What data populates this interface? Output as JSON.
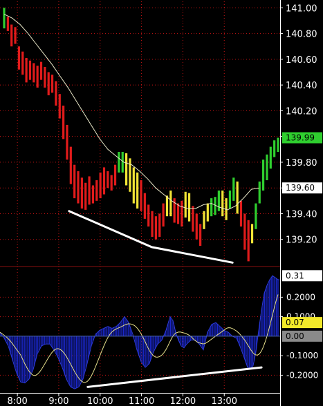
{
  "chart_data": [
    {
      "type": "bar",
      "panel": "price",
      "ylim": [
        139.0,
        141.05
      ],
      "yticks": [
        "141.00",
        "140.80",
        "140.60",
        "140.40",
        "140.20",
        "140.00",
        "139.80",
        "139.60",
        "139.40",
        "139.20"
      ],
      "ytick_values": [
        141.0,
        140.8,
        140.6,
        140.4,
        140.2,
        140.0,
        139.8,
        139.6,
        139.4,
        139.2
      ],
      "last_price_tag": "139.99",
      "ma_price_tag": "139.60",
      "colors": {
        "down": "#e11b1b",
        "up_weak": "#f2e436",
        "up": "#2fcf2f",
        "ma": "#e9e7c8",
        "trendline": "#ffffff",
        "grid": "#c81414",
        "axis_bg": "#000000"
      },
      "bars": [
        {
          "h": 141.0,
          "l": 140.84,
          "c": "g"
        },
        {
          "h": 140.93,
          "l": 140.82,
          "c": "r"
        },
        {
          "h": 140.87,
          "l": 140.7,
          "c": "r"
        },
        {
          "h": 140.85,
          "l": 140.72,
          "c": "r"
        },
        {
          "h": 140.7,
          "l": 140.52,
          "c": "r"
        },
        {
          "h": 140.66,
          "l": 140.48,
          "c": "r"
        },
        {
          "h": 140.61,
          "l": 140.42,
          "c": "r"
        },
        {
          "h": 140.59,
          "l": 140.44,
          "c": "r"
        },
        {
          "h": 140.57,
          "l": 140.42,
          "c": "r"
        },
        {
          "h": 140.55,
          "l": 140.38,
          "c": "r"
        },
        {
          "h": 140.58,
          "l": 140.44,
          "c": "r"
        },
        {
          "h": 140.54,
          "l": 140.38,
          "c": "r"
        },
        {
          "h": 140.5,
          "l": 140.32,
          "c": "r"
        },
        {
          "h": 140.48,
          "l": 140.34,
          "c": "r"
        },
        {
          "h": 140.43,
          "l": 140.24,
          "c": "r"
        },
        {
          "h": 140.33,
          "l": 140.14,
          "c": "r"
        },
        {
          "h": 140.24,
          "l": 139.98,
          "c": "r"
        },
        {
          "h": 140.09,
          "l": 139.82,
          "c": "r"
        },
        {
          "h": 139.92,
          "l": 139.63,
          "c": "r"
        },
        {
          "h": 139.78,
          "l": 139.52,
          "c": "r"
        },
        {
          "h": 139.73,
          "l": 139.48,
          "c": "r"
        },
        {
          "h": 139.68,
          "l": 139.44,
          "c": "r"
        },
        {
          "h": 139.64,
          "l": 139.43,
          "c": "r"
        },
        {
          "h": 139.69,
          "l": 139.47,
          "c": "r"
        },
        {
          "h": 139.62,
          "l": 139.48,
          "c": "r"
        },
        {
          "h": 139.66,
          "l": 139.5,
          "c": "r"
        },
        {
          "h": 139.72,
          "l": 139.52,
          "c": "r"
        },
        {
          "h": 139.76,
          "l": 139.55,
          "c": "r"
        },
        {
          "h": 139.73,
          "l": 139.6,
          "c": "r"
        },
        {
          "h": 139.7,
          "l": 139.58,
          "c": "r"
        },
        {
          "h": 139.78,
          "l": 139.62,
          "c": "r"
        },
        {
          "h": 139.88,
          "l": 139.72,
          "c": "g"
        },
        {
          "h": 139.88,
          "l": 139.72,
          "c": "g"
        },
        {
          "h": 139.87,
          "l": 139.62,
          "c": "y"
        },
        {
          "h": 139.83,
          "l": 139.57,
          "c": "y"
        },
        {
          "h": 139.76,
          "l": 139.48,
          "c": "y"
        },
        {
          "h": 139.72,
          "l": 139.44,
          "c": "y"
        },
        {
          "h": 139.66,
          "l": 139.42,
          "c": "r"
        },
        {
          "h": 139.56,
          "l": 139.36,
          "c": "r"
        },
        {
          "h": 139.47,
          "l": 139.3,
          "c": "r"
        },
        {
          "h": 139.42,
          "l": 139.22,
          "c": "r"
        },
        {
          "h": 139.38,
          "l": 139.2,
          "c": "r"
        },
        {
          "h": 139.4,
          "l": 139.22,
          "c": "r"
        },
        {
          "h": 139.48,
          "l": 139.3,
          "c": "r"
        },
        {
          "h": 139.54,
          "l": 139.38,
          "c": "y"
        },
        {
          "h": 139.58,
          "l": 139.38,
          "c": "y"
        },
        {
          "h": 139.52,
          "l": 139.33,
          "c": "r"
        },
        {
          "h": 139.48,
          "l": 139.32,
          "c": "r"
        },
        {
          "h": 139.5,
          "l": 139.3,
          "c": "r"
        },
        {
          "h": 139.57,
          "l": 139.37,
          "c": "y"
        },
        {
          "h": 139.56,
          "l": 139.34,
          "c": "y"
        },
        {
          "h": 139.46,
          "l": 139.26,
          "c": "r"
        },
        {
          "h": 139.4,
          "l": 139.2,
          "c": "r"
        },
        {
          "h": 139.32,
          "l": 139.15,
          "c": "r"
        },
        {
          "h": 139.42,
          "l": 139.28,
          "c": "y"
        },
        {
          "h": 139.48,
          "l": 139.34,
          "c": "y"
        },
        {
          "h": 139.52,
          "l": 139.38,
          "c": "g"
        },
        {
          "h": 139.53,
          "l": 139.39,
          "c": "g"
        },
        {
          "h": 139.58,
          "l": 139.42,
          "c": "g"
        },
        {
          "h": 139.58,
          "l": 139.38,
          "c": "y"
        },
        {
          "h": 139.52,
          "l": 139.35,
          "c": "y"
        },
        {
          "h": 139.58,
          "l": 139.44,
          "c": "g"
        },
        {
          "h": 139.68,
          "l": 139.5,
          "c": "g"
        },
        {
          "h": 139.65,
          "l": 139.4,
          "c": "y"
        },
        {
          "h": 139.5,
          "l": 139.3,
          "c": "r"
        },
        {
          "h": 139.4,
          "l": 139.12,
          "c": "r"
        },
        {
          "h": 139.35,
          "l": 139.03,
          "c": "r"
        },
        {
          "h": 139.32,
          "l": 139.17,
          "c": "y"
        },
        {
          "h": 139.48,
          "l": 139.28,
          "c": "g"
        },
        {
          "h": 139.65,
          "l": 139.48,
          "c": "g"
        },
        {
          "h": 139.82,
          "l": 139.58,
          "c": "g"
        },
        {
          "h": 139.86,
          "l": 139.66,
          "c": "g"
        },
        {
          "h": 139.92,
          "l": 139.75,
          "c": "g"
        },
        {
          "h": 139.97,
          "l": 139.84,
          "c": "g"
        },
        {
          "h": 139.99,
          "l": 139.88,
          "c": "g"
        }
      ],
      "ma": [
        140.95,
        140.92,
        140.87,
        140.8,
        140.72,
        140.64,
        140.56,
        140.47,
        140.38,
        140.28,
        140.18,
        140.08,
        139.98,
        139.9,
        139.85,
        139.8,
        139.78,
        139.73,
        139.67,
        139.6,
        139.55,
        139.5,
        139.46,
        139.44,
        139.44,
        139.47,
        139.48,
        139.45,
        139.43,
        139.46,
        139.52,
        139.59,
        139.6
      ],
      "trendline": [
        [
          9.25,
          139.42
        ],
        [
          11.25,
          139.14
        ],
        [
          13.2,
          139.02
        ]
      ]
    },
    {
      "type": "area",
      "panel": "oscillator",
      "ylim": [
        -0.28,
        0.35
      ],
      "yticks": [
        "0.2000",
        "0.1000",
        "-0.1000",
        "-0.2000"
      ],
      "ytick_values": [
        0.2,
        0.1,
        -0.1,
        -0.2
      ],
      "tags": {
        "value": "0.31",
        "signal": "0.07",
        "zero": "0.00"
      },
      "colors": {
        "hist": "#1a27c8",
        "signal": "#e6df8c",
        "zero": "#4a63b0",
        "trendline": "#ffffff"
      },
      "trendline": [
        [
          9.7,
          -0.26
        ],
        [
          13.9,
          -0.16
        ]
      ]
    }
  ],
  "x_axis": {
    "labels": [
      "8:00",
      "9:00",
      "10:00",
      "11:00",
      "12:00",
      "13:00"
    ],
    "positions": [
      8,
      9,
      10,
      11,
      12,
      13
    ],
    "xlim": [
      7.58,
      14.35
    ]
  }
}
